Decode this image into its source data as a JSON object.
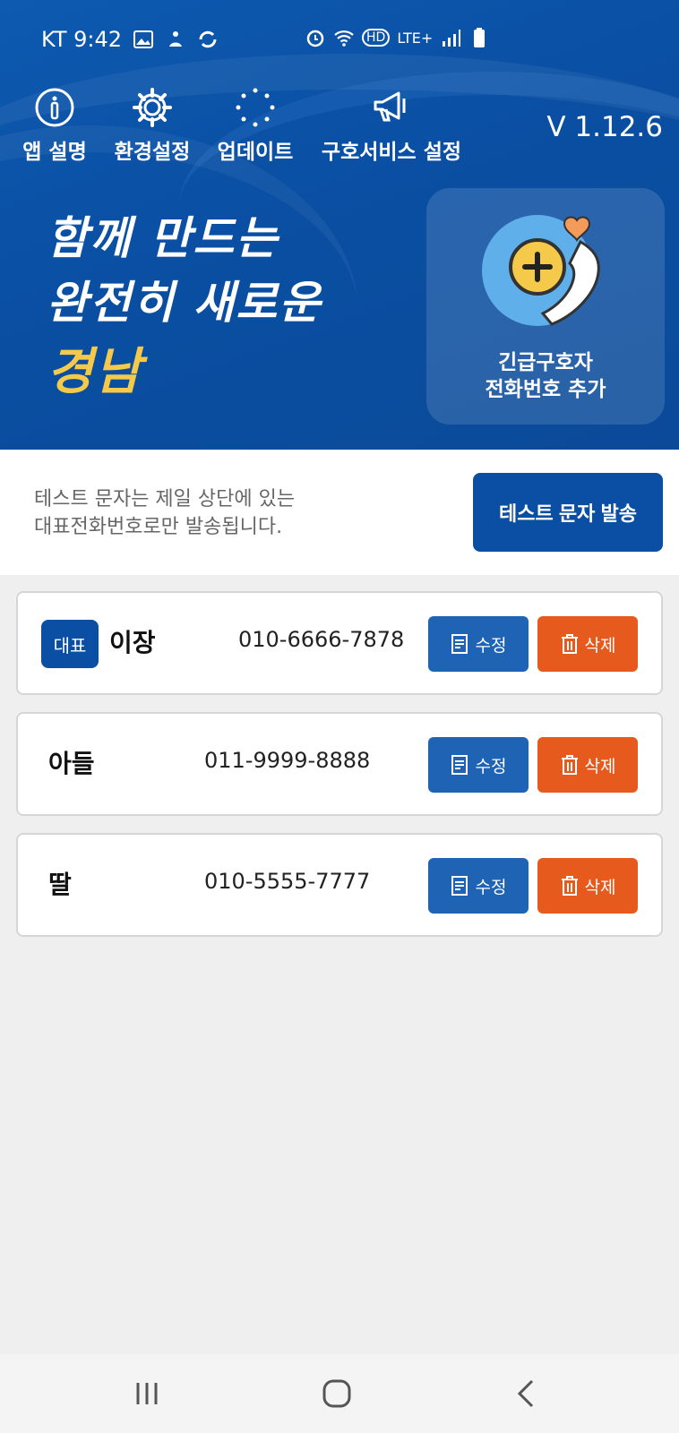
{
  "status_bar": {
    "carrier_time": "KT 9:42",
    "network": "LTE+",
    "hd": "HD"
  },
  "nav": {
    "items": [
      {
        "label": "앱 설명",
        "icon": "info-icon"
      },
      {
        "label": "환경설정",
        "icon": "gear-icon"
      },
      {
        "label": "업데이트",
        "icon": "update-spinner-icon"
      },
      {
        "label": "구호서비스 설정",
        "icon": "megaphone-icon"
      }
    ],
    "version": "V 1.12.6"
  },
  "banner": {
    "line1": "함께 만드는",
    "line2": "완전히 새로운",
    "line3": "경남"
  },
  "add_contact": {
    "line1": "긴급구호자",
    "line2": "전화번호 추가"
  },
  "test_section": {
    "line1": "테스트 문자는 제일 상단에 있는",
    "line2": "대표전화번호로만 발송됩니다.",
    "button_label": "테스트 문자 발송"
  },
  "contacts": [
    {
      "badge": "대표",
      "name": "이장",
      "phone": "010-6666-7878",
      "edit_label": "수정",
      "delete_label": "삭제"
    },
    {
      "badge": "",
      "name": "아들",
      "phone": "011-9999-8888",
      "edit_label": "수정",
      "delete_label": "삭제"
    },
    {
      "badge": "",
      "name": "딸",
      "phone": "010-5555-7777",
      "edit_label": "수정",
      "delete_label": "삭제"
    }
  ],
  "colors": {
    "primary_blue": "#0a4fa3",
    "edit_blue": "#1f63b4",
    "delete_orange": "#e75a1e",
    "slogan_gold": "#f5c94a"
  }
}
